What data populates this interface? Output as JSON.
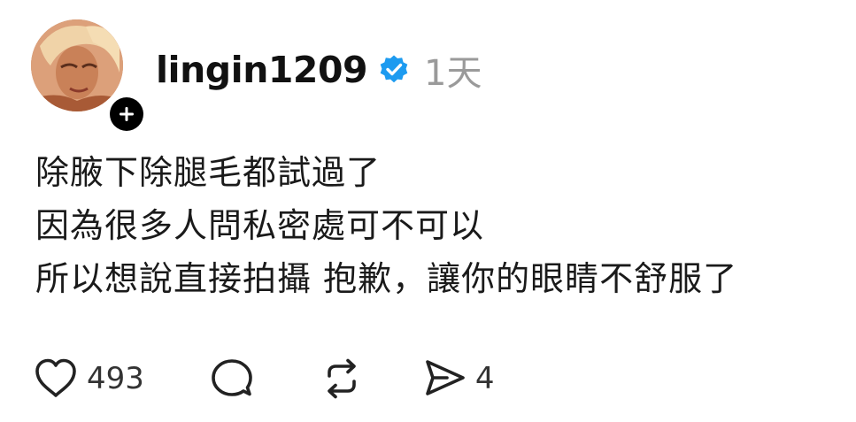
{
  "post": {
    "username": "lingin1209",
    "timestamp": "1天",
    "verified": true,
    "lines": [
      "除腋下除腿毛都試過了",
      "因為很多人問私密處可不可以",
      "所以想說直接拍攝 抱歉，讓你的眼睛不舒服了"
    ]
  },
  "actions": {
    "like_count": "493",
    "share_count": "4"
  },
  "colors": {
    "verified_blue": "#1d9bf0",
    "text": "#1a1a1a",
    "muted": "#9a9a9a"
  },
  "icons": {
    "avatar": "profile-photo",
    "follow": "plus-icon",
    "verified": "verified-badge-icon",
    "like": "heart-icon",
    "comment": "comment-icon",
    "repost": "repost-icon",
    "share": "send-icon"
  }
}
